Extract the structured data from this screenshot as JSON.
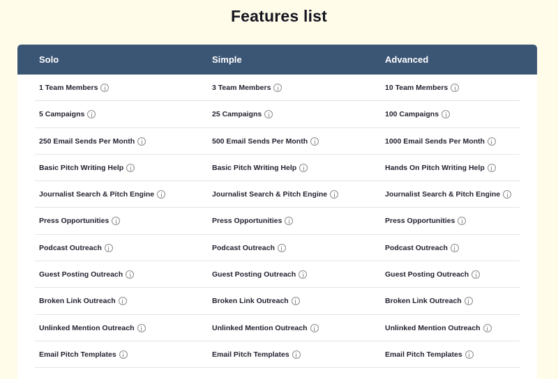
{
  "page": {
    "title": "Features list"
  },
  "table": {
    "columns": [
      "Solo",
      "Simple",
      "Advanced"
    ],
    "rows": [
      [
        "1 Team Members",
        "3 Team Members",
        "10 Team Members"
      ],
      [
        "5 Campaigns",
        "25 Campaigns",
        "100 Campaigns"
      ],
      [
        "250 Email Sends Per Month",
        "500 Email Sends Per Month",
        "1000 Email Sends Per Month"
      ],
      [
        "Basic Pitch Writing Help",
        "Basic Pitch Writing Help",
        "Hands On Pitch Writing Help"
      ],
      [
        "Journalist Search & Pitch Engine",
        "Journalist Search & Pitch Engine",
        "Journalist Search & Pitch Engine"
      ],
      [
        "Press Opportunities",
        "Press Opportunities",
        "Press Opportunities"
      ],
      [
        "Podcast Outreach",
        "Podcast Outreach",
        "Podcast Outreach"
      ],
      [
        "Guest Posting Outreach",
        "Guest Posting Outreach",
        "Guest Posting Outreach"
      ],
      [
        "Broken Link Outreach",
        "Broken Link Outreach",
        "Broken Link Outreach"
      ],
      [
        "Unlinked Mention Outreach",
        "Unlinked Mention Outreach",
        "Unlinked Mention Outreach"
      ],
      [
        "Email Pitch Templates",
        "Email Pitch Templates",
        "Email Pitch Templates"
      ]
    ],
    "icon": "info-icon"
  },
  "colors": {
    "background": "#fffcea",
    "header": "#3b5575",
    "header_text": "#ffffff",
    "row_border": "#e4e4e4"
  }
}
